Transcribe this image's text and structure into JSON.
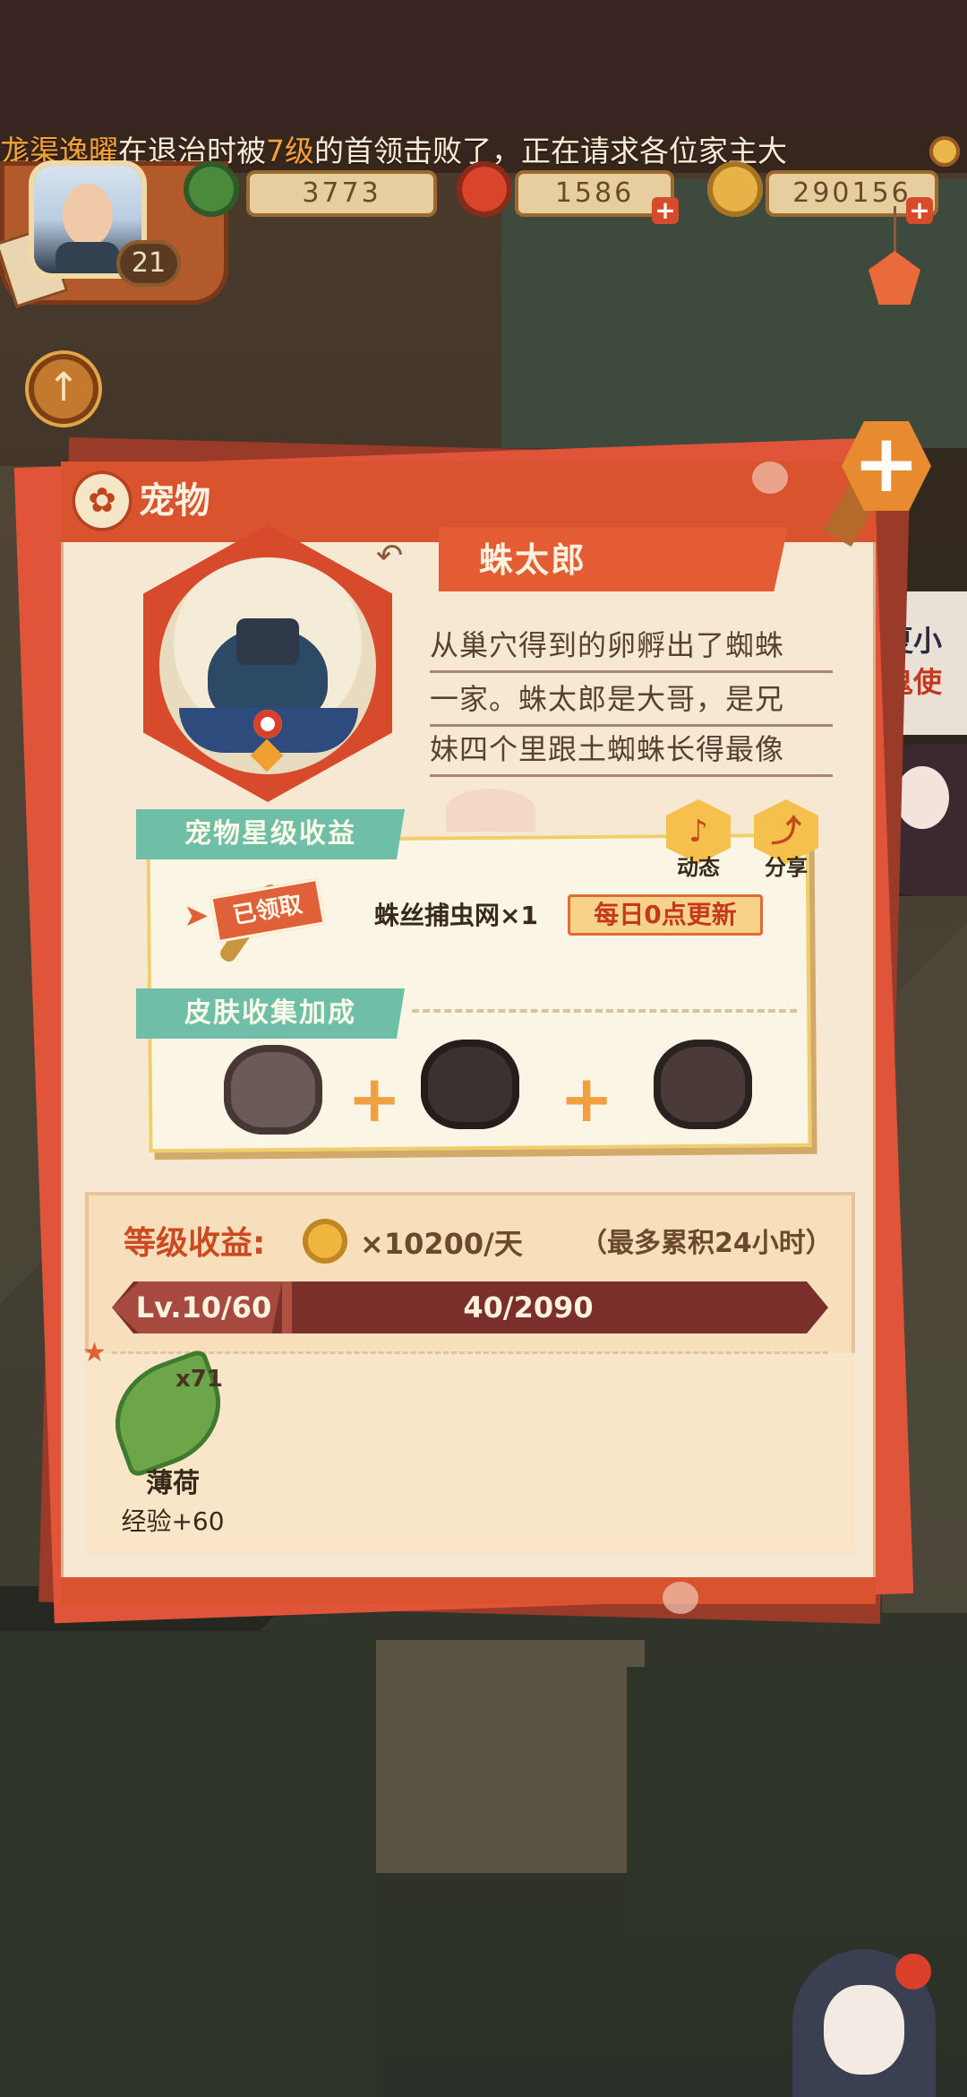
{
  "announcement": {
    "player": "尨渠逸曜",
    "text_a": "在退治时被",
    "level": "7级",
    "text_b": "的首领击败了，正在请求各位家主大"
  },
  "player": {
    "level": "21"
  },
  "resources": {
    "jade": "3773",
    "stamina": "1586",
    "coins": "290156"
  },
  "side_banner": {
    "title": "夏小",
    "subtitle": "鬼使"
  },
  "panel": {
    "title": "宠物",
    "close_glyph": "+"
  },
  "pet": {
    "name": "蛛太郎",
    "description_lines": [
      "从巢穴得到的卵孵出了蜘蛛",
      "一家。蛛太郎是大哥，是兄",
      "妹四个里跟土蜘蛛长得最像"
    ]
  },
  "star_income": {
    "label": "宠物星级收益",
    "claimed": "已领取",
    "reward": "蛛丝捕虫网×1",
    "refresh_tag": "每日0点更新",
    "actions": {
      "dynamic": "动态",
      "share": "分享"
    }
  },
  "skin_bonus": {
    "label": "皮肤收集加成",
    "skins": [
      "skin-1",
      "skin-2",
      "skin-3"
    ]
  },
  "level_income": {
    "label": "等级收益:",
    "rate": "×10200/天",
    "cap": "（最多累积24小时）",
    "level": "Lv.10/60",
    "exp": "40/2090",
    "exp_current": 40,
    "exp_max": 2090
  },
  "items": [
    {
      "name": "薄荷",
      "count": "x71",
      "effect": "经验+60"
    }
  ],
  "colors": {
    "accent_red": "#d9532f",
    "teal_label": "#6fbfa8",
    "panel_bg": "#f6e8d2",
    "level_bar": "#7a2f2a"
  }
}
